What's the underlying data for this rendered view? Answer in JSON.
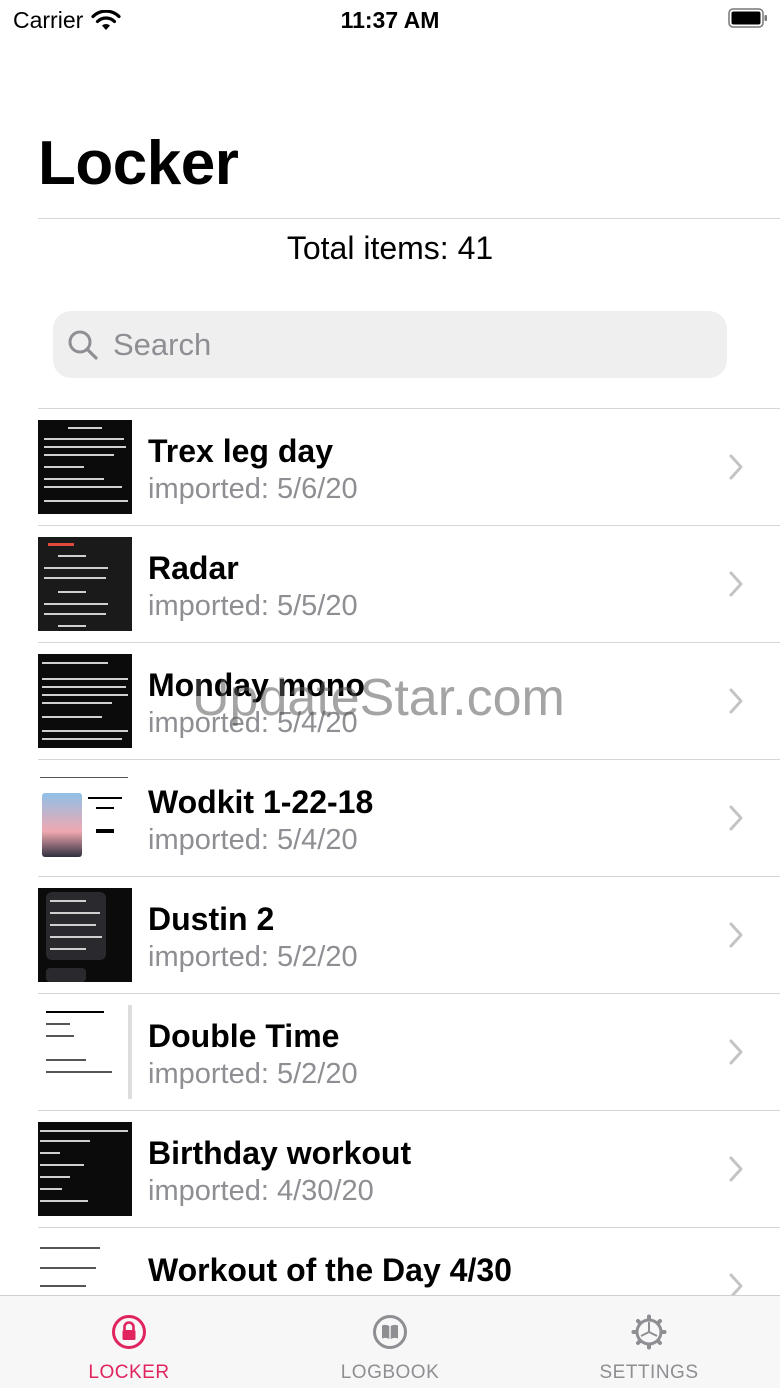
{
  "status": {
    "carrier": "Carrier",
    "time": "11:37 AM"
  },
  "header": {
    "title": "Locker",
    "total": "Total items: 41"
  },
  "search": {
    "placeholder": "Search",
    "value": ""
  },
  "items": [
    {
      "name": "Trex leg day",
      "imported": "imported: 5/6/20",
      "thumb": "dark"
    },
    {
      "name": "Radar",
      "imported": "imported: 5/5/20",
      "thumb": "dark"
    },
    {
      "name": "Monday mono",
      "imported": "imported: 5/4/20",
      "thumb": "dark"
    },
    {
      "name": "Wodkit 1-22-18",
      "imported": "imported: 5/4/20",
      "thumb": "light"
    },
    {
      "name": "Dustin 2",
      "imported": "imported: 5/2/20",
      "thumb": "dark"
    },
    {
      "name": "Double Time",
      "imported": "imported: 5/2/20",
      "thumb": "light"
    },
    {
      "name": "Birthday workout",
      "imported": "imported: 4/30/20",
      "thumb": "dark"
    },
    {
      "name": "Workout of the Day 4/30",
      "imported": "",
      "thumb": "light"
    }
  ],
  "watermark": "UpdateStar.com",
  "tabs": [
    {
      "label": "LOCKER",
      "icon": "lock-icon",
      "active": true
    },
    {
      "label": "LOGBOOK",
      "icon": "book-icon",
      "active": false
    },
    {
      "label": "SETTINGS",
      "icon": "gear-icon",
      "active": false
    }
  ],
  "colors": {
    "accent": "#e0245e",
    "inactive": "#8e8e93",
    "secondary_text": "#8e8e93"
  }
}
